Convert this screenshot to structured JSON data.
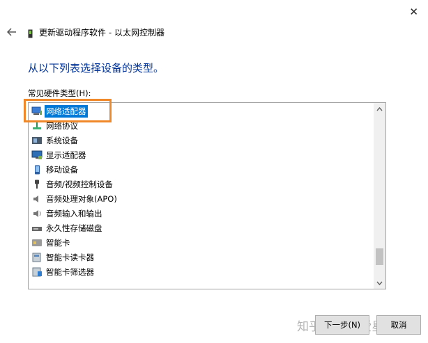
{
  "window": {
    "title": "更新驱动程序软件 - 以太网控制器",
    "close_glyph": "✕"
  },
  "heading": "从以下列表选择设备的类型。",
  "list_label": "常见硬件类型(H):",
  "list_items": [
    {
      "label": "网络适配器",
      "icon": "network-adapter-icon",
      "selected": true
    },
    {
      "label": "网络协议",
      "icon": "network-protocol-icon",
      "selected": false
    },
    {
      "label": "系统设备",
      "icon": "system-device-icon",
      "selected": false
    },
    {
      "label": "显示适配器",
      "icon": "display-adapter-icon",
      "selected": false
    },
    {
      "label": "移动设备",
      "icon": "mobile-device-icon",
      "selected": false
    },
    {
      "label": "音频/视频控制设备",
      "icon": "audio-video-controller-icon",
      "selected": false
    },
    {
      "label": "音频处理对象(APO)",
      "icon": "audio-processing-icon",
      "selected": false
    },
    {
      "label": "音频输入和输出",
      "icon": "speaker-icon",
      "selected": false
    },
    {
      "label": "永久性存储磁盘",
      "icon": "storage-disk-icon",
      "selected": false
    },
    {
      "label": "智能卡",
      "icon": "smart-card-icon",
      "selected": false
    },
    {
      "label": "智能卡读卡器",
      "icon": "smart-card-reader-icon",
      "selected": false
    },
    {
      "label": "智能卡筛选器",
      "icon": "smart-card-filter-icon",
      "selected": false
    }
  ],
  "scrollbar": {
    "position": 0.92
  },
  "buttons": {
    "next": "下一步(N)",
    "cancel": "取消"
  },
  "watermark": "知乎 @菜鸟爱星空",
  "colors": {
    "selection": "#0078d7",
    "heading": "#003399",
    "annotation": "#f0882a"
  }
}
